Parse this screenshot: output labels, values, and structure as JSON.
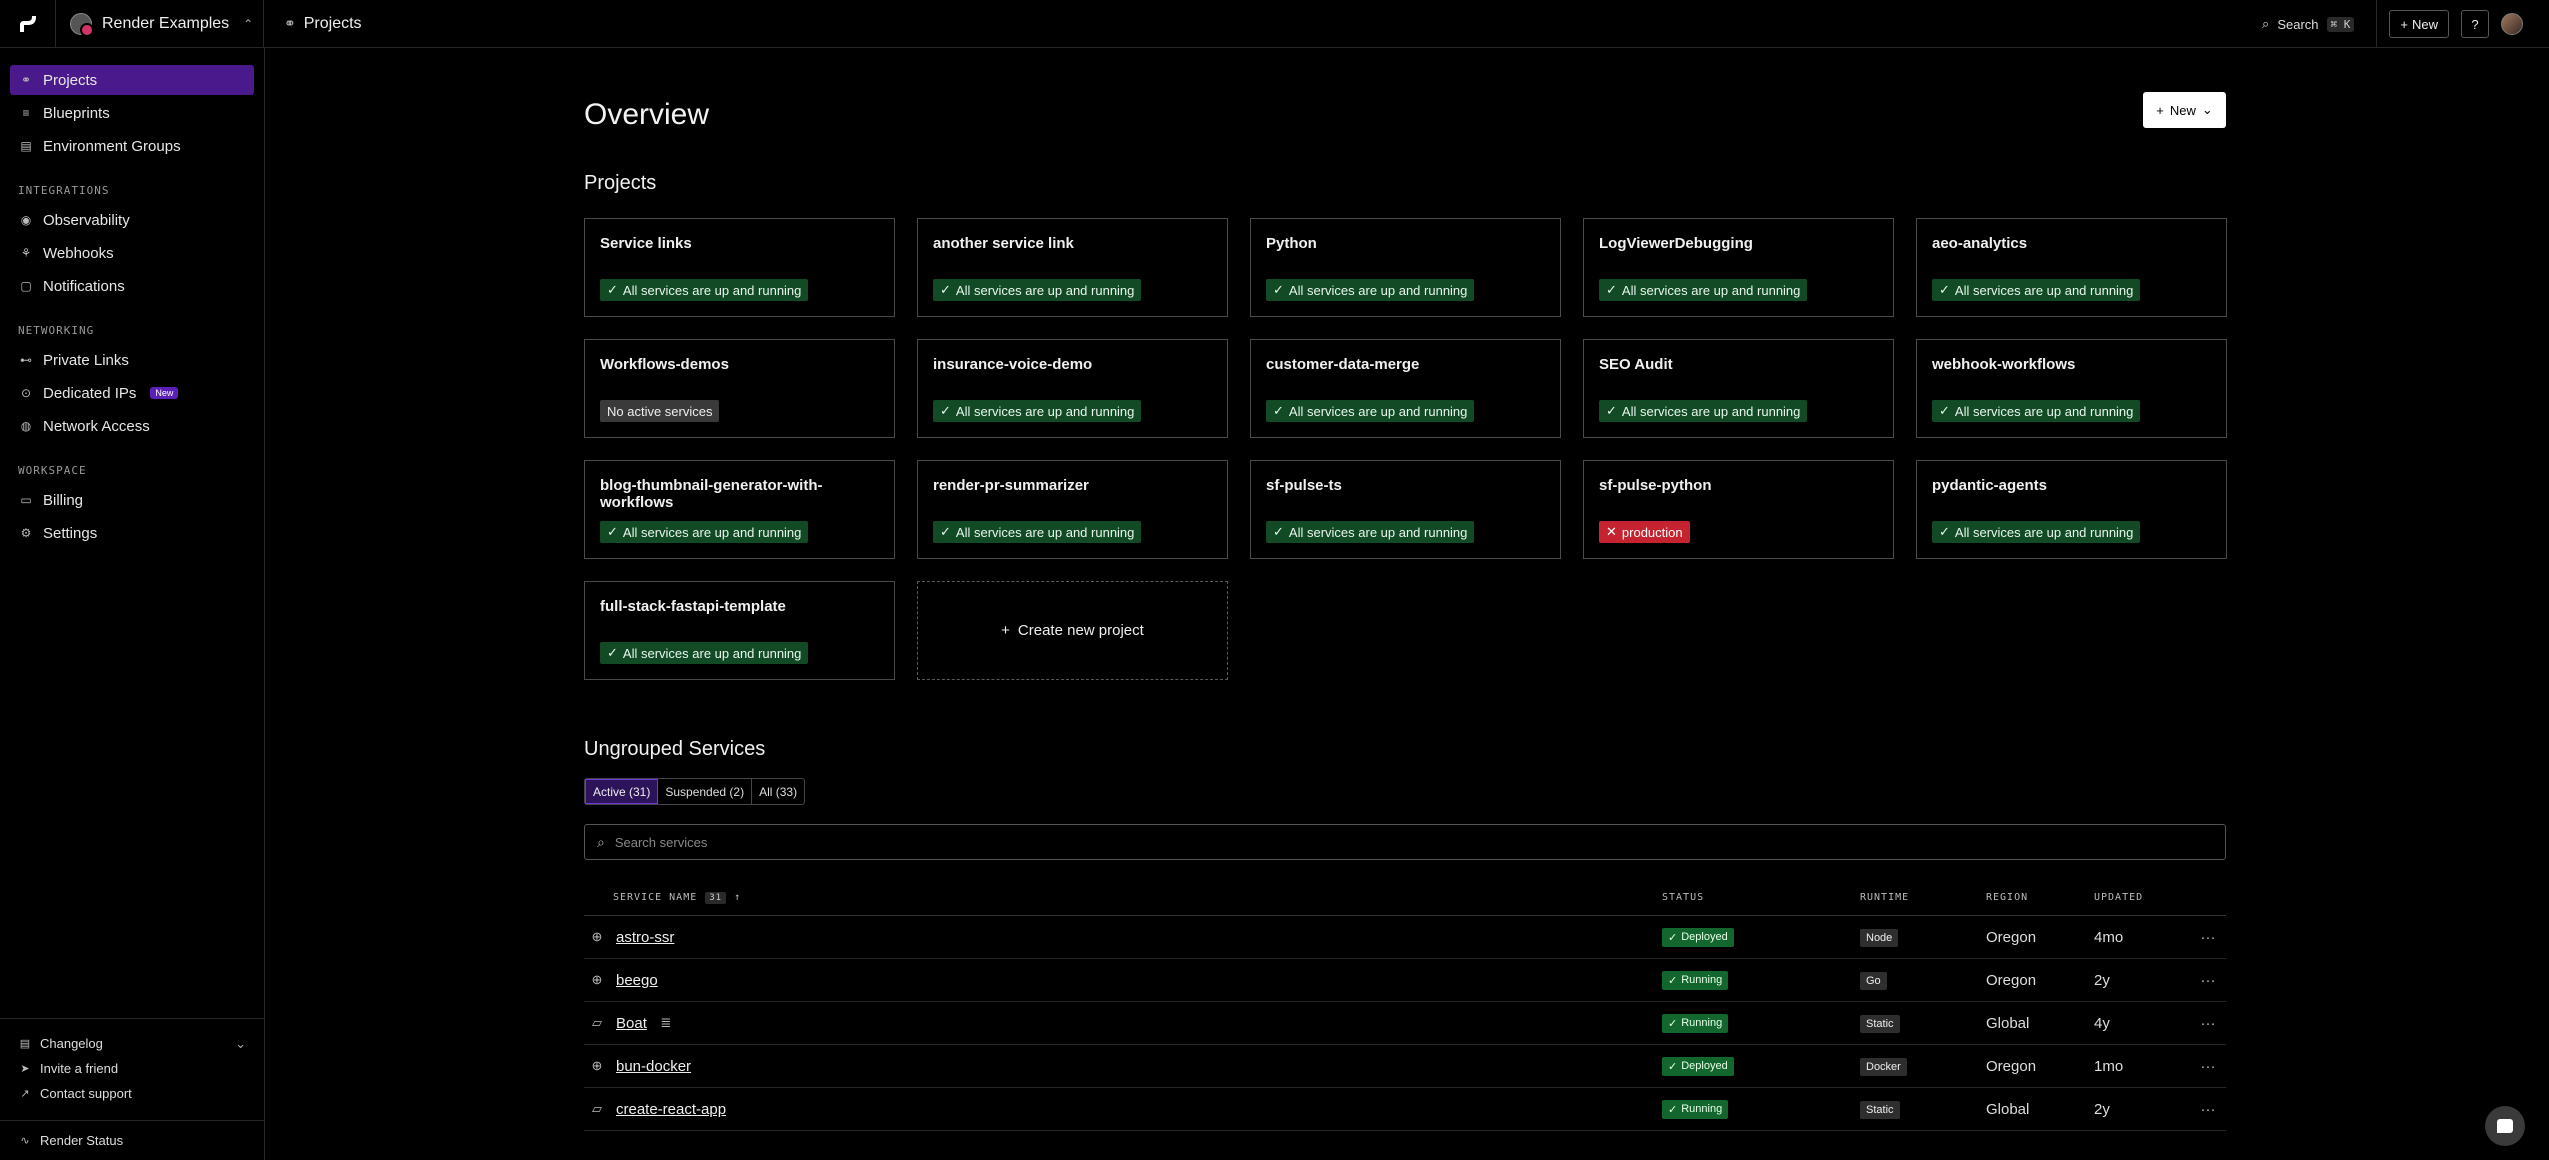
{
  "workspace": {
    "name": "Render Examples"
  },
  "breadcrumb": {
    "label": "Projects"
  },
  "topbar": {
    "search_label": "Search",
    "search_kbd": "⌘ K",
    "new_label": "New"
  },
  "sidebar": {
    "main": [
      {
        "label": "Projects",
        "icon": "projects-icon"
      },
      {
        "label": "Blueprints",
        "icon": "blueprints-icon"
      },
      {
        "label": "Environment Groups",
        "icon": "env-groups-icon"
      }
    ],
    "integrations_heading": "INTEGRATIONS",
    "integrations": [
      {
        "label": "Observability"
      },
      {
        "label": "Webhooks"
      },
      {
        "label": "Notifications"
      }
    ],
    "networking_heading": "NETWORKING",
    "networking": [
      {
        "label": "Private Links"
      },
      {
        "label": "Dedicated IPs",
        "badge": "New"
      },
      {
        "label": "Network Access"
      }
    ],
    "workspace_heading": "WORKSPACE",
    "workspace": [
      {
        "label": "Billing"
      },
      {
        "label": "Settings"
      }
    ],
    "bottom": {
      "changelog": "Changelog",
      "invite": "Invite a friend",
      "support": "Contact support",
      "status": "Render Status"
    }
  },
  "main": {
    "title": "Overview",
    "new_label": "New",
    "projects_heading": "Projects",
    "projects": [
      {
        "name": "Service links",
        "status": "All services are up and running",
        "kind": "ok"
      },
      {
        "name": "another service link",
        "status": "All services are up and running",
        "kind": "ok"
      },
      {
        "name": "Python",
        "status": "All services are up and running",
        "kind": "ok"
      },
      {
        "name": "LogViewerDebugging",
        "status": "All services are up and running",
        "kind": "ok"
      },
      {
        "name": "aeo-analytics",
        "status": "All services are up and running",
        "kind": "ok"
      },
      {
        "name": "Workflows-demos",
        "status": "No active services",
        "kind": "neutral"
      },
      {
        "name": "insurance-voice-demo",
        "status": "All services are up and running",
        "kind": "ok"
      },
      {
        "name": "customer-data-merge",
        "status": "All services are up and running",
        "kind": "ok"
      },
      {
        "name": "SEO Audit",
        "status": "All services are up and running",
        "kind": "ok"
      },
      {
        "name": "webhook-workflows",
        "status": "All services are up and running",
        "kind": "ok"
      },
      {
        "name": "blog-thumbnail-generator-with-workflows",
        "status": "All services are up and running",
        "kind": "ok"
      },
      {
        "name": "render-pr-summarizer",
        "status": "All services are up and running",
        "kind": "ok"
      },
      {
        "name": "sf-pulse-ts",
        "status": "All services are up and running",
        "kind": "ok"
      },
      {
        "name": "sf-pulse-python",
        "status": "production",
        "kind": "error"
      },
      {
        "name": "pydantic-agents",
        "status": "All services are up and running",
        "kind": "ok"
      },
      {
        "name": "full-stack-fastapi-template",
        "status": "All services are up and running",
        "kind": "ok"
      }
    ],
    "create_project_label": "Create new project",
    "ungrouped_heading": "Ungrouped Services",
    "tabs": [
      {
        "label": "Active (31)",
        "active": true
      },
      {
        "label": "Suspended (2)",
        "active": false
      },
      {
        "label": "All (33)",
        "active": false
      }
    ],
    "search_placeholder": "Search services",
    "table": {
      "headers": {
        "name": "SERVICE NAME",
        "count": "31",
        "status": "STATUS",
        "runtime": "RUNTIME",
        "region": "REGION",
        "updated": "UPDATED"
      },
      "rows": [
        {
          "icon": "globe-icon",
          "name": "astro-ssr",
          "status": "Deployed",
          "runtime": "Node",
          "region": "Oregon",
          "updated": "4mo"
        },
        {
          "icon": "globe-icon",
          "name": "beego",
          "status": "Running",
          "runtime": "Go",
          "region": "Oregon",
          "updated": "2y"
        },
        {
          "icon": "static-site-icon",
          "name": "Boat",
          "status": "Running",
          "runtime": "Static",
          "region": "Global",
          "updated": "4y",
          "extra_icon": true
        },
        {
          "icon": "globe-icon",
          "name": "bun-docker",
          "status": "Deployed",
          "runtime": "Docker",
          "region": "Oregon",
          "updated": "1mo"
        },
        {
          "icon": "static-site-icon",
          "name": "create-react-app",
          "status": "Running",
          "runtime": "Static",
          "region": "Global",
          "updated": "2y"
        }
      ]
    }
  },
  "colors": {
    "accent": "#4a1a8c",
    "ok": "#124a26",
    "error": "#c4232f"
  }
}
